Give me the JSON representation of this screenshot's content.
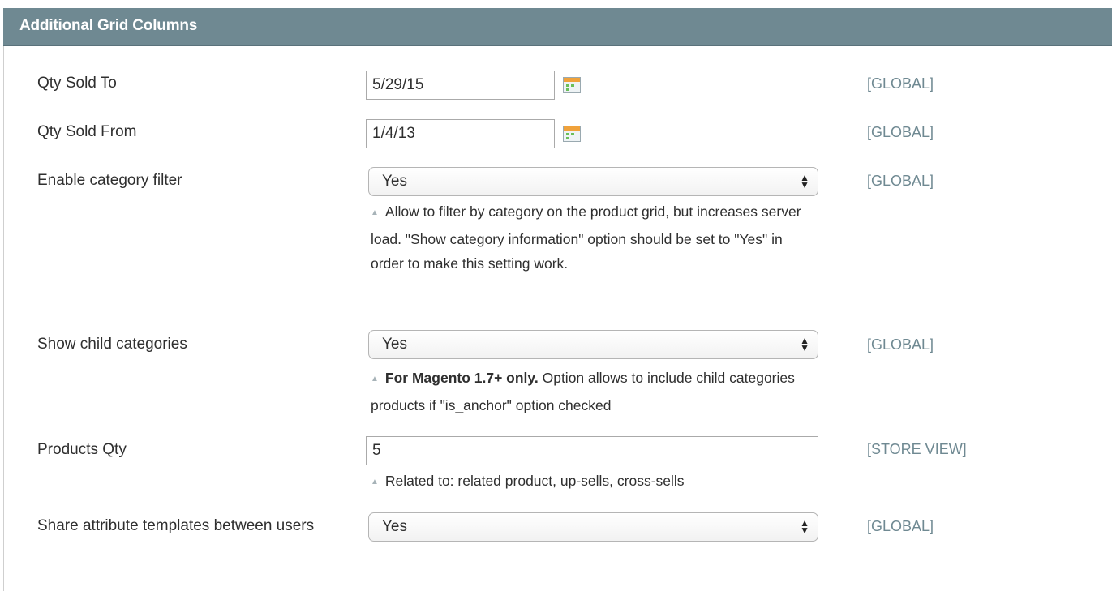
{
  "section": {
    "title": "Additional Grid Columns"
  },
  "fields": {
    "qty_sold_to": {
      "label": "Qty Sold To",
      "value": "5/29/15",
      "scope": "[GLOBAL]"
    },
    "qty_sold_from": {
      "label": "Qty Sold From",
      "value": "1/4/13",
      "scope": "[GLOBAL]"
    },
    "enable_category_filter": {
      "label": "Enable category filter",
      "value": "Yes",
      "scope": "[GLOBAL]",
      "note": "Allow to filter by category on the product grid, but increases server load. \"Show category information\" option should be set to \"Yes\" in order to make this setting work."
    },
    "show_child_categories": {
      "label": "Show child categories",
      "value": "Yes",
      "scope": "[GLOBAL]",
      "note_bold": "For Magento 1.7+ only.",
      "note": "Option allows to include child categories products if \"is_anchor\" option checked"
    },
    "products_qty": {
      "label": "Products Qty",
      "value": "5",
      "scope": "[STORE VIEW]",
      "note": "Related to: related product, up-sells, cross-sells"
    },
    "share_attribute_templates": {
      "label": "Share attribute templates between users",
      "value": "Yes",
      "scope": "[GLOBAL]"
    }
  },
  "icons": {
    "calendar": "calendar-icon",
    "select_arrows": "up-down-arrows-icon",
    "note_marker": "triangle-up-icon"
  },
  "colors": {
    "header_bg": "#6f8992",
    "scope_text": "#6f8992"
  }
}
